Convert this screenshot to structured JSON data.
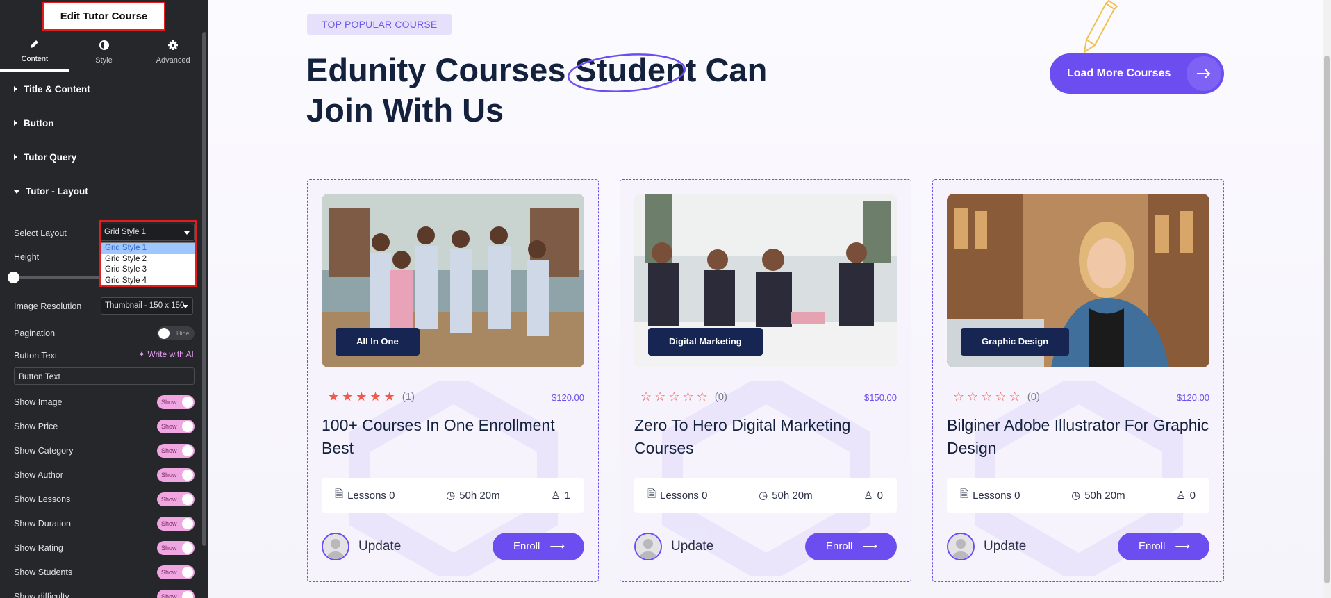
{
  "panel": {
    "title": "Edit Tutor Course",
    "tabs": [
      {
        "label": "Content",
        "icon": "pencil-icon"
      },
      {
        "label": "Style",
        "icon": "half-circle-icon"
      },
      {
        "label": "Advanced",
        "icon": "gear-icon"
      }
    ],
    "sections": [
      {
        "label": "Title & Content"
      },
      {
        "label": "Button"
      },
      {
        "label": "Tutor Query"
      },
      {
        "label": "Tutor - Layout"
      }
    ],
    "layout": {
      "select_layout_label": "Select Layout",
      "select_layout_value": "Grid Style 1",
      "layout_options": [
        "Grid Style 1",
        "Grid Style 2",
        "Grid Style 3",
        "Grid Style 4"
      ],
      "height_label": "Height",
      "image_resolution_label": "Image Resolution",
      "image_resolution_value": "Thumbnail - 150 x 150",
      "pagination_label": "Pagination",
      "pagination_state": "Hide",
      "button_text_label": "Button Text",
      "write_ai": "Write with AI",
      "button_text_value": "Button Text",
      "toggles": [
        {
          "label": "Show Image",
          "state": "Show"
        },
        {
          "label": "Show Price",
          "state": "Show"
        },
        {
          "label": "Show Category",
          "state": "Show"
        },
        {
          "label": "Show Author",
          "state": "Show"
        },
        {
          "label": "Show Lessons",
          "state": "Show"
        },
        {
          "label": "Show Duration",
          "state": "Show"
        },
        {
          "label": "Show Rating",
          "state": "Show"
        },
        {
          "label": "Show Students",
          "state": "Show"
        },
        {
          "label": "Show difficulty",
          "state": "Show"
        }
      ]
    }
  },
  "page": {
    "badge": "TOP POPULAR COURSE",
    "headline_1": "Edunity Courses Student Can",
    "headline_2": "Join With Us",
    "load_more": "Load More Courses",
    "accent": "#6c4df0",
    "navy": "#14213d",
    "courses": [
      {
        "category": "All In One",
        "rating": 5,
        "rating_count": "(1)",
        "price": "$120.00",
        "title": "100+ Courses In One Enrollment Best",
        "lessons": "Lessons 0",
        "duration": "50h  20m",
        "students": "1",
        "author": "Update",
        "enroll": "Enroll"
      },
      {
        "category": "Digital Marketing",
        "rating": 0,
        "rating_count": "(0)",
        "price": "$150.00",
        "title": "Zero To Hero Digital Marketing Courses",
        "lessons": "Lessons 0",
        "duration": "50h  20m",
        "students": "0",
        "author": "Update",
        "enroll": "Enroll"
      },
      {
        "category": "Graphic Design",
        "rating": 0,
        "rating_count": "(0)",
        "price": "$120.00",
        "title": "Bilginer Adobe Illustrator For Graphic Design",
        "lessons": "Lessons 0",
        "duration": "50h  20m",
        "students": "0",
        "author": "Update",
        "enroll": "Enroll"
      }
    ]
  }
}
